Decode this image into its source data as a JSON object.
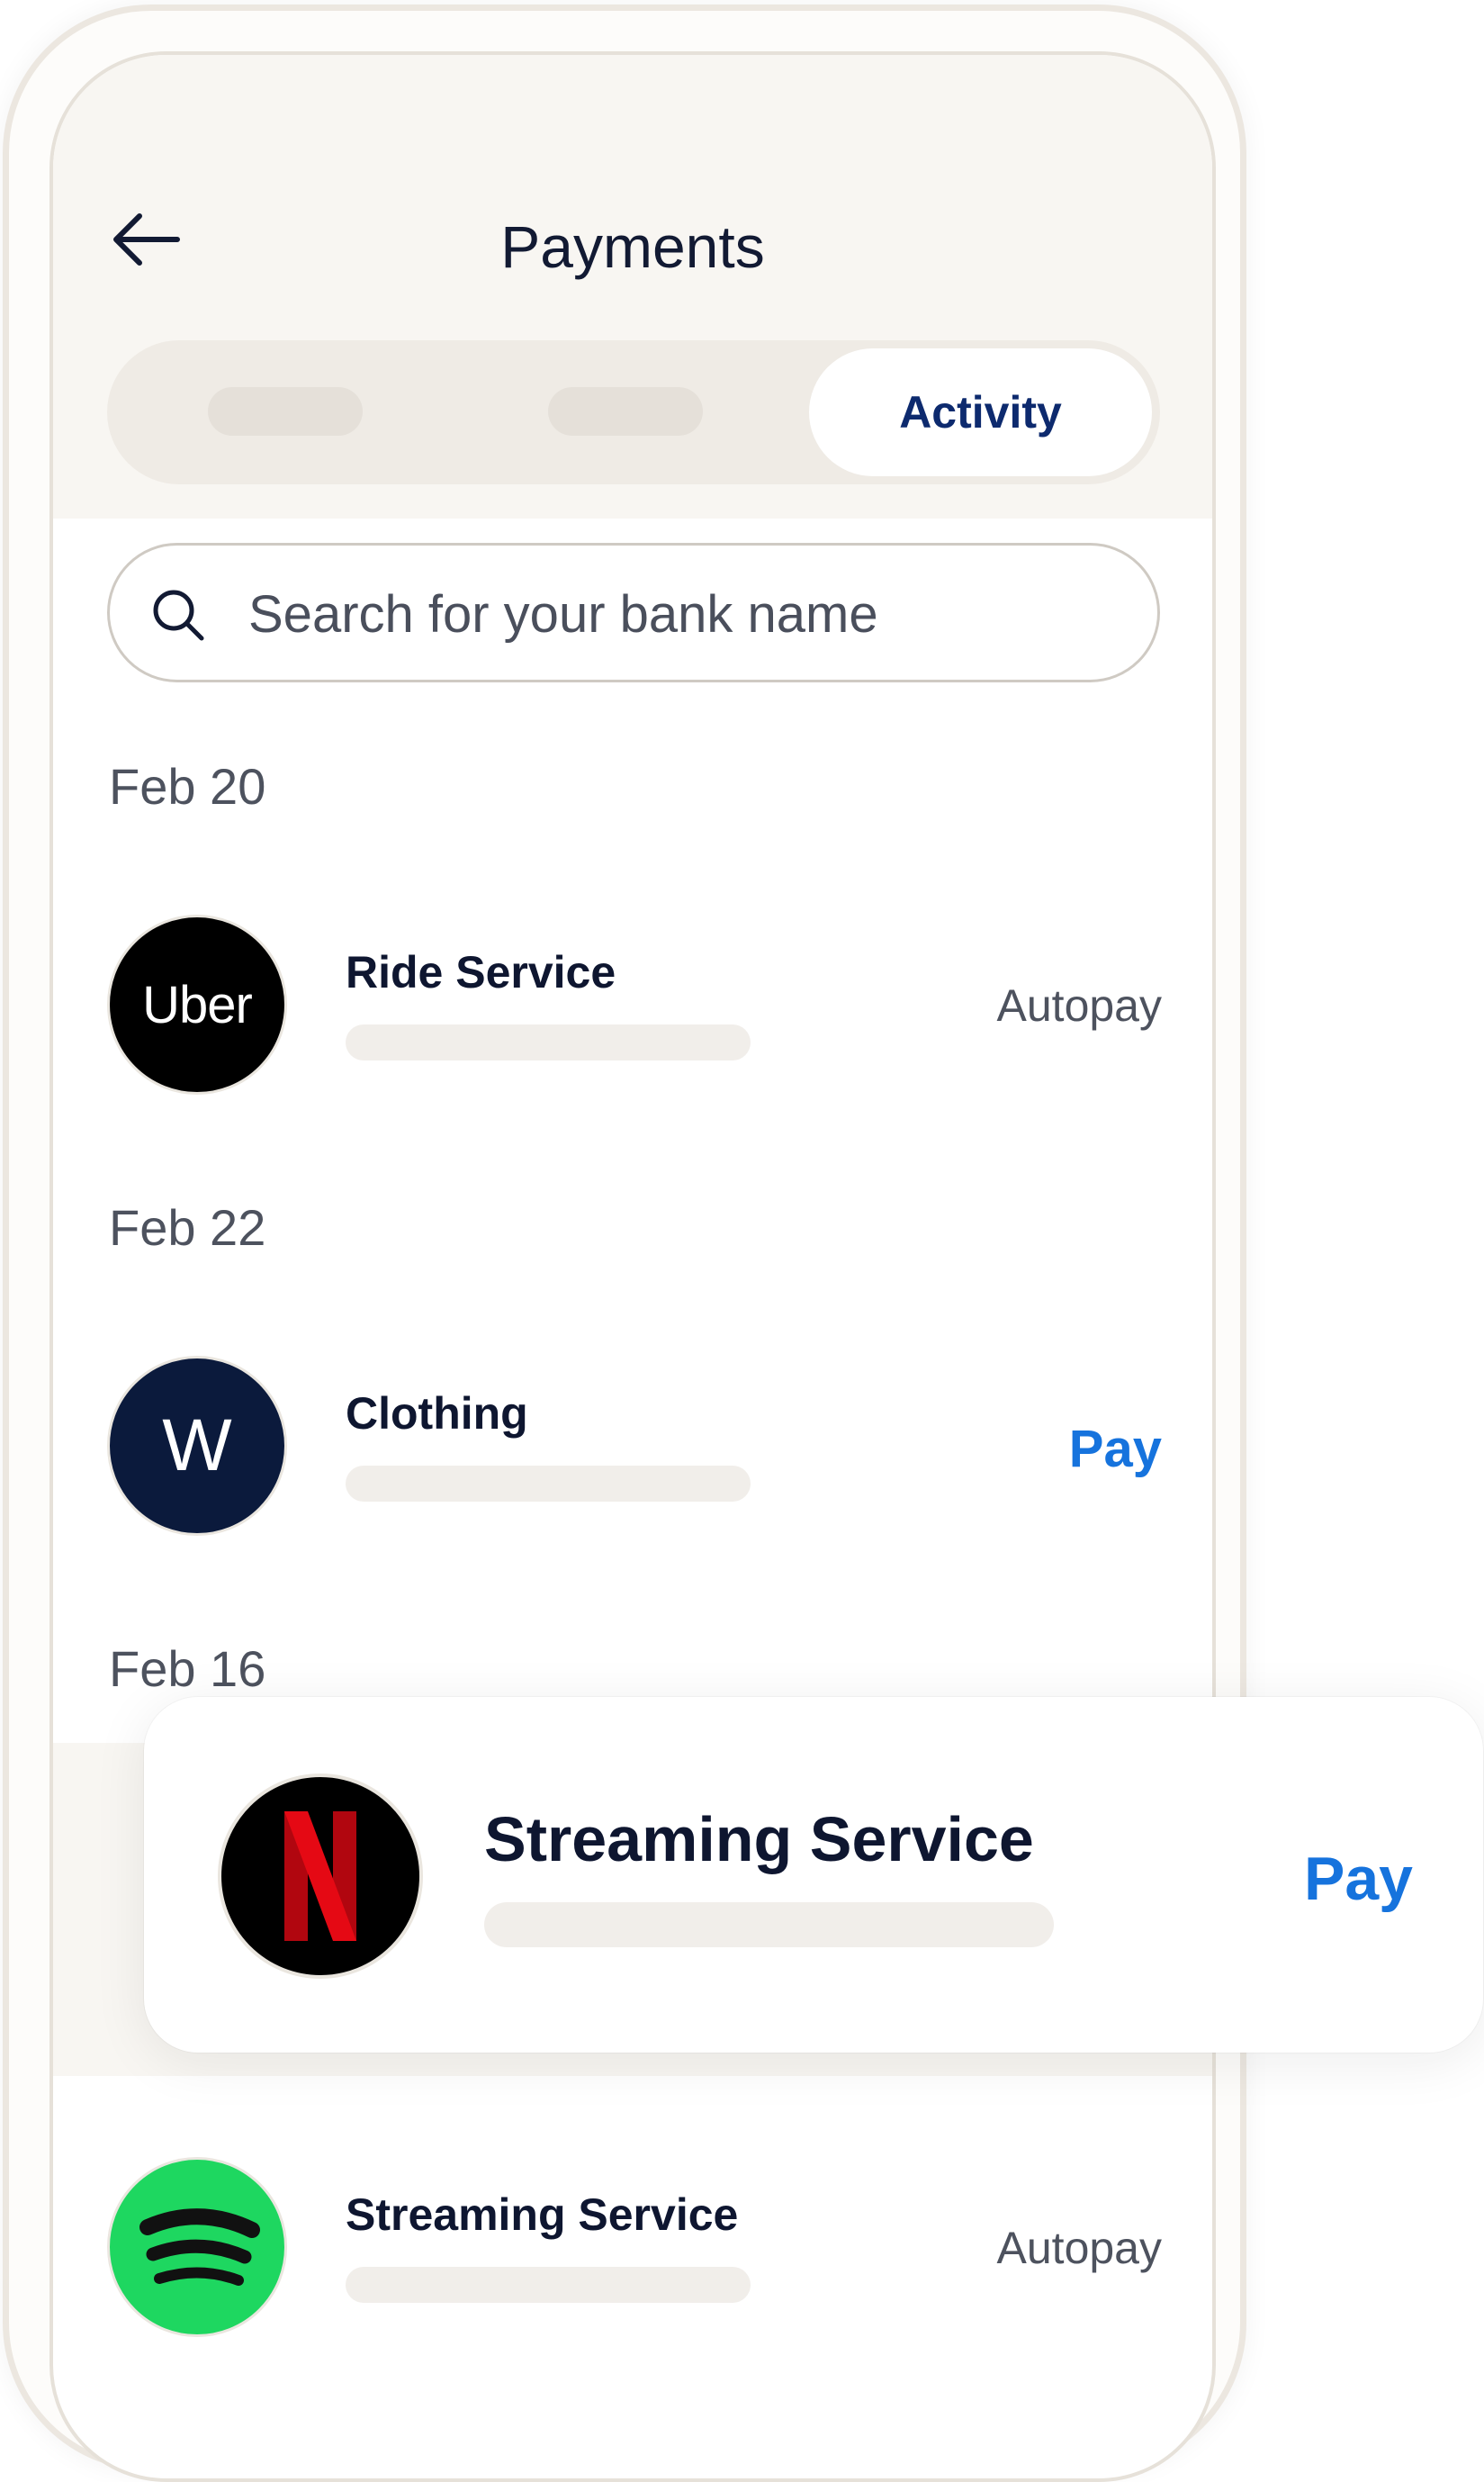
{
  "header": {
    "title": "Payments",
    "back_icon": "arrow-left-icon"
  },
  "tabs": {
    "active_label": "Activity"
  },
  "search": {
    "placeholder": "Search for your bank name",
    "icon": "search-icon"
  },
  "groups": [
    {
      "date": "Feb 20",
      "item": {
        "logo_text": "Uber",
        "title": "Ride Service",
        "status": "Autopay"
      }
    },
    {
      "date": "Feb 22",
      "item": {
        "logo_text": "W",
        "title": "Clothing",
        "action": "Pay"
      }
    },
    {
      "date": "Feb 16",
      "item": {
        "title": "Streaming Service",
        "action": "Pay"
      }
    },
    {
      "item": {
        "title": "Streaming Service",
        "status": "Autopay"
      }
    }
  ],
  "colors": {
    "accent_blue": "#1673dd",
    "title_navy": "#0d2a6e",
    "spotify_green": "#1ed760",
    "netflix_red": "#e50914"
  }
}
